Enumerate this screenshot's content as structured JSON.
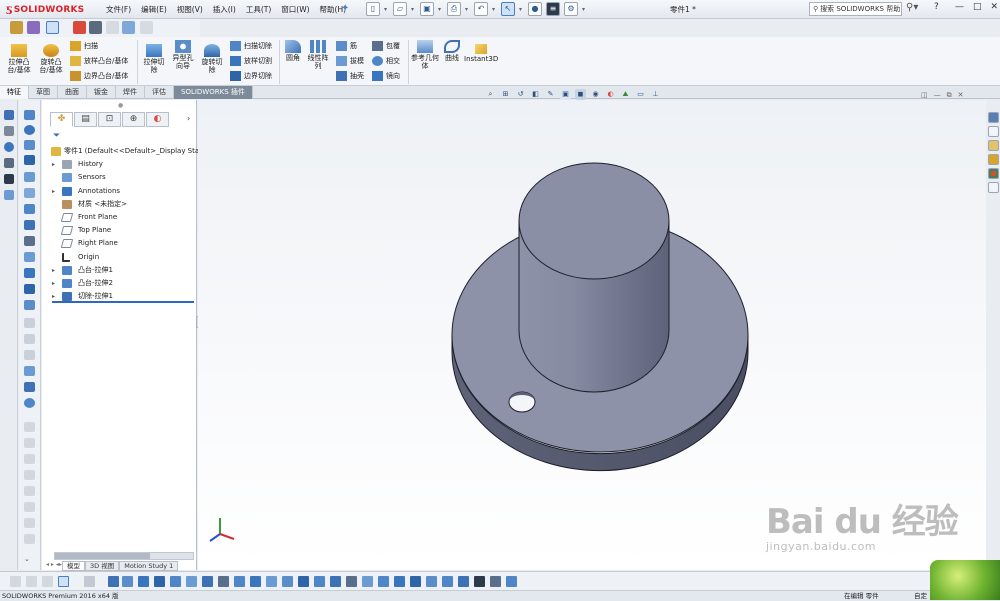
{
  "app": {
    "brand": "SOLIDWORKS",
    "document_title": "零件1 *",
    "menus": [
      "文件(F)",
      "编辑(E)",
      "视图(V)",
      "插入(I)",
      "工具(T)",
      "窗口(W)",
      "帮助(H)"
    ],
    "help_search_placeholder": "搜索 SOLIDWORKS 帮助",
    "help_label": "?",
    "window_controls": [
      "—",
      "□",
      "✕"
    ]
  },
  "ribbon": {
    "big_buttons": [
      {
        "label": "拉伸凸台/基体",
        "icon": "extruded-boss-icon"
      },
      {
        "label": "旋转凸台/基体",
        "icon": "revolved-boss-icon"
      },
      {
        "label": "拉伸切除",
        "icon": "extruded-cut-icon"
      },
      {
        "label": "异型孔向导",
        "icon": "hole-wizard-icon"
      },
      {
        "label": "旋转切除",
        "icon": "revolved-cut-icon"
      },
      {
        "label": "圆角",
        "icon": "fillet-icon"
      },
      {
        "label": "线性阵列",
        "icon": "linear-pattern-icon"
      },
      {
        "label": "参考几何体",
        "icon": "reference-geometry-icon"
      },
      {
        "label": "曲线",
        "icon": "curves-icon"
      },
      {
        "label": "Instant3D",
        "icon": "instant3d-icon"
      }
    ],
    "small_col1": [
      "扫描",
      "放样凸台/基体",
      "边界凸台/基体"
    ],
    "small_col2": [
      "扫描切除",
      "放样切割",
      "边界切除"
    ],
    "small_col3": [
      "筋",
      "拔模",
      "抽壳"
    ],
    "small_col4": [
      "包覆",
      "相交",
      "镜向"
    ]
  },
  "tabs": [
    "特征",
    "草图",
    "曲面",
    "钣金",
    "焊件",
    "评估",
    "SOLIDWORKS 插件"
  ],
  "feature_tree": {
    "root": "零件1  (Default<<Default>_Display Sta",
    "items": [
      {
        "label": "History",
        "expandable": true
      },
      {
        "label": "Sensors",
        "expandable": false
      },
      {
        "label": "Annotations",
        "expandable": true
      },
      {
        "label": "材质 <未指定>",
        "expandable": false
      },
      {
        "label": "Front Plane",
        "expandable": false
      },
      {
        "label": "Top Plane",
        "expandable": false
      },
      {
        "label": "Right Plane",
        "expandable": false
      },
      {
        "label": "Origin",
        "expandable": false
      },
      {
        "label": "凸台-拉伸1",
        "expandable": true
      },
      {
        "label": "凸台-拉伸2",
        "expandable": true
      },
      {
        "label": "切除-拉伸1",
        "expandable": true
      }
    ]
  },
  "bottom_tabs": [
    "模型",
    "3D 视图",
    "Motion Study 1"
  ],
  "status": {
    "version": "SOLIDWORKS Premium 2016 x64 版",
    "mode": "在编辑 零件",
    "units": "自定"
  },
  "watermark": {
    "main": "Bai du 经验",
    "url": "jingyan.baidu.com"
  },
  "colors": {
    "brand_red": "#d8232a",
    "part_face": "#8c91a8",
    "selection_blue": "#2f68c4"
  }
}
